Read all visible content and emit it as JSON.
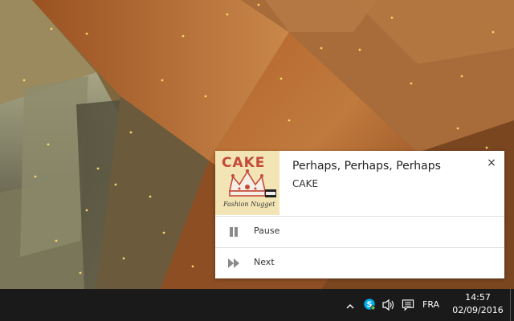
{
  "notification": {
    "title": "Perhaps, Perhaps, Perhaps",
    "artist": "CAKE",
    "close_symbol": "×",
    "album_art": {
      "band_text": "CAKE",
      "album_title_text": "Fashion Nugget",
      "background_color": "#f2e4b4",
      "text_color": "#c44a3a"
    },
    "actions": [
      {
        "label": "Pause",
        "icon": "pause-icon"
      },
      {
        "label": "Next",
        "icon": "next-icon"
      }
    ]
  },
  "taskbar": {
    "tray_icons": [
      "chevron-up-icon",
      "skype-icon",
      "volume-icon",
      "action-center-icon"
    ],
    "language": "FRA",
    "time": "14:57",
    "date": "02/09/2016"
  },
  "colors": {
    "taskbar": "#1a1a1a",
    "notification_bg": "#ffffff",
    "skype_blue": "#00aff0"
  }
}
